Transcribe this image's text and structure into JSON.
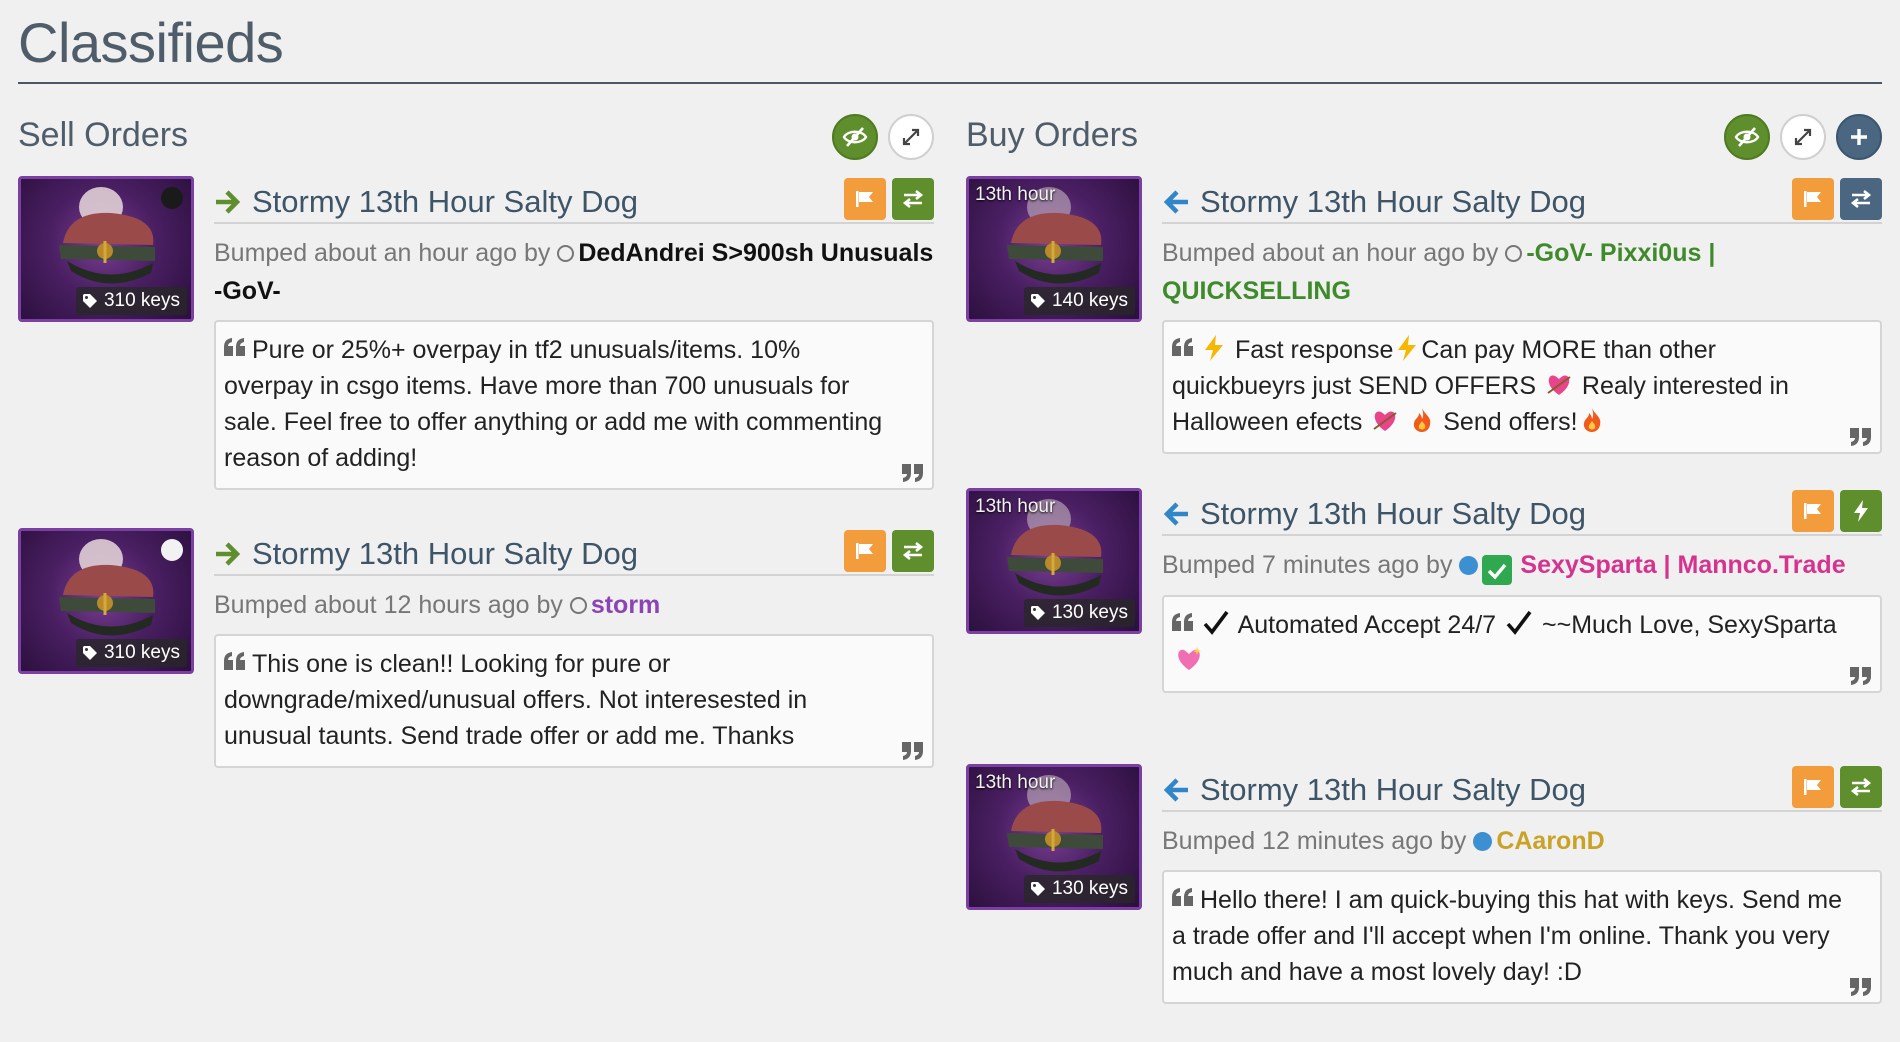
{
  "page": {
    "title": "Classifieds"
  },
  "colors": {
    "sell_arrow": "#5e8f2c",
    "buy_arrow": "#2f86c9",
    "price_tag_bg": "#2a2a2a",
    "quality_unusual": "#7b3fa3"
  },
  "sell": {
    "title": "Sell Orders",
    "listings": [
      {
        "item_name": "Stormy 13th Hour Salty Dog",
        "price": "310 keys",
        "bumped_text": "Bumped about an hour ago by",
        "user": "DedAndrei S>900sh Unusuals -GoV-",
        "user_color": "#111111",
        "comment": "Pure or 25%+ overpay in tf2 unusuals/items. 10% overpay in csgo items. Have more than 700 unusuals for sale. Feel free to offer anything or add me with commenting reason of adding!"
      },
      {
        "item_name": "Stormy 13th Hour Salty Dog",
        "price": "310 keys",
        "bumped_text": "Bumped about 12 hours ago by",
        "user": "storm",
        "user_color": "#8b44b5",
        "comment": "This one is clean!! Looking for pure or downgrade/mixed/unusual offers. Not interesested in unusual taunts. Send trade offer or add me. Thanks"
      }
    ]
  },
  "buy": {
    "title": "Buy Orders",
    "listings": [
      {
        "item_name": "Stormy 13th Hour Salty Dog",
        "effect_label": "13th hour",
        "price": "140 keys",
        "bumped_text": "Bumped about an hour ago by",
        "user": "-GoV- Pixxi0us | QUICKSELLING",
        "user_color": "#3f8a2a",
        "comment_parts": [
          "Fast response",
          "Can pay MORE than other quickbueyrs just SEND OFFERS",
          "Realy interested in Halloween efects",
          "Send offers!"
        ]
      },
      {
        "item_name": "Stormy 13th Hour Salty Dog",
        "effect_label": "13th hour",
        "price": "130 keys",
        "bumped_text": "Bumped 7 minutes ago by",
        "user": "SexySparta | Mannco.Trade",
        "user_color": "#d6338f",
        "comment_parts": [
          "Automated Accept 24/7",
          "~~Much Love, SexySparta"
        ]
      },
      {
        "item_name": "Stormy 13th Hour Salty Dog",
        "effect_label": "13th hour",
        "price": "130 keys",
        "bumped_text": "Bumped 12 minutes ago by",
        "user": "CAaronD",
        "user_color": "#c9a227",
        "comment": "Hello there! I am quick-buying this hat with keys. Send me a trade offer and I'll accept when I'm online. Thank you very much and have a most lovely day! :D"
      }
    ]
  },
  "icons": {
    "hide": "eye-slash-icon",
    "expand": "expand-icon",
    "add": "plus-icon",
    "report": "flag-icon",
    "trade": "exchange-icon",
    "instant": "bolt-icon",
    "tag": "tag-icon",
    "quote_open": "quote-left-icon",
    "quote_close": "quote-right-icon"
  }
}
